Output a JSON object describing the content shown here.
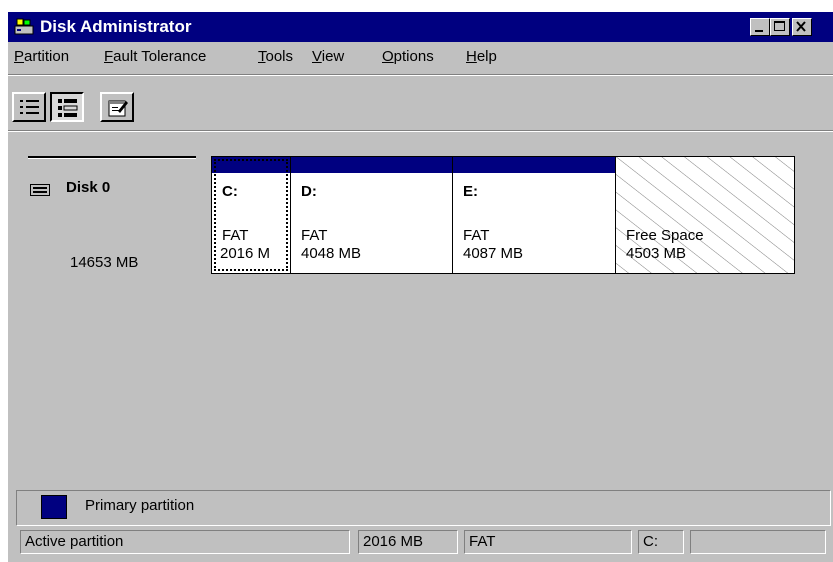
{
  "window": {
    "title": "Disk Administrator"
  },
  "title_buttons": [
    {
      "name": "minimize-button",
      "icon": "minimize-icon"
    },
    {
      "name": "maximize-button",
      "icon": "maximize-icon"
    },
    {
      "name": "close-button",
      "icon": "close-icon"
    }
  ],
  "menu": [
    {
      "key": "partition",
      "accel": "P",
      "rest": "artition"
    },
    {
      "key": "fault-tolerance",
      "accel": "F",
      "rest": "ault Tolerance"
    },
    {
      "key": "tools",
      "accel": "T",
      "rest": "ools"
    },
    {
      "key": "view",
      "accel": "V",
      "rest": "iew"
    },
    {
      "key": "options",
      "accel": "O",
      "rest": "ptions"
    },
    {
      "key": "help",
      "accel": "H",
      "rest": "elp"
    }
  ],
  "toolbar": [
    {
      "name": "volumes-view-button",
      "icon": "volumes-list-icon",
      "state": "raised"
    },
    {
      "name": "disk-configuration-view-button",
      "icon": "disk-configuration-icon",
      "state": "pressed"
    },
    {
      "name": "properties-button",
      "icon": "properties-icon",
      "state": "raised"
    }
  ],
  "disk": {
    "name": "Disk 0",
    "size": "14653 MB",
    "icon": "hard-disk-icon"
  },
  "partitions": [
    {
      "letter": "C:",
      "fs": "FAT",
      "size": "2016 M",
      "selected": true,
      "size_mb": 2016
    },
    {
      "letter": "D:",
      "fs": "FAT",
      "size": "4048 MB",
      "selected": false,
      "size_mb": 4048
    },
    {
      "letter": "E:",
      "fs": "FAT",
      "size": "4087 MB",
      "selected": false,
      "size_mb": 4087
    }
  ],
  "free_space": {
    "label": "Free Space",
    "size": "4503 MB"
  },
  "legend": {
    "label": "Primary partition",
    "color": "#000080"
  },
  "status": {
    "description": "Active partition",
    "size": "2016 MB",
    "fs": "FAT",
    "drive": "C:",
    "extra": ""
  },
  "colors": {
    "titlebar": "#000080",
    "face": "#c0c0c0",
    "primary_partition": "#000080"
  }
}
